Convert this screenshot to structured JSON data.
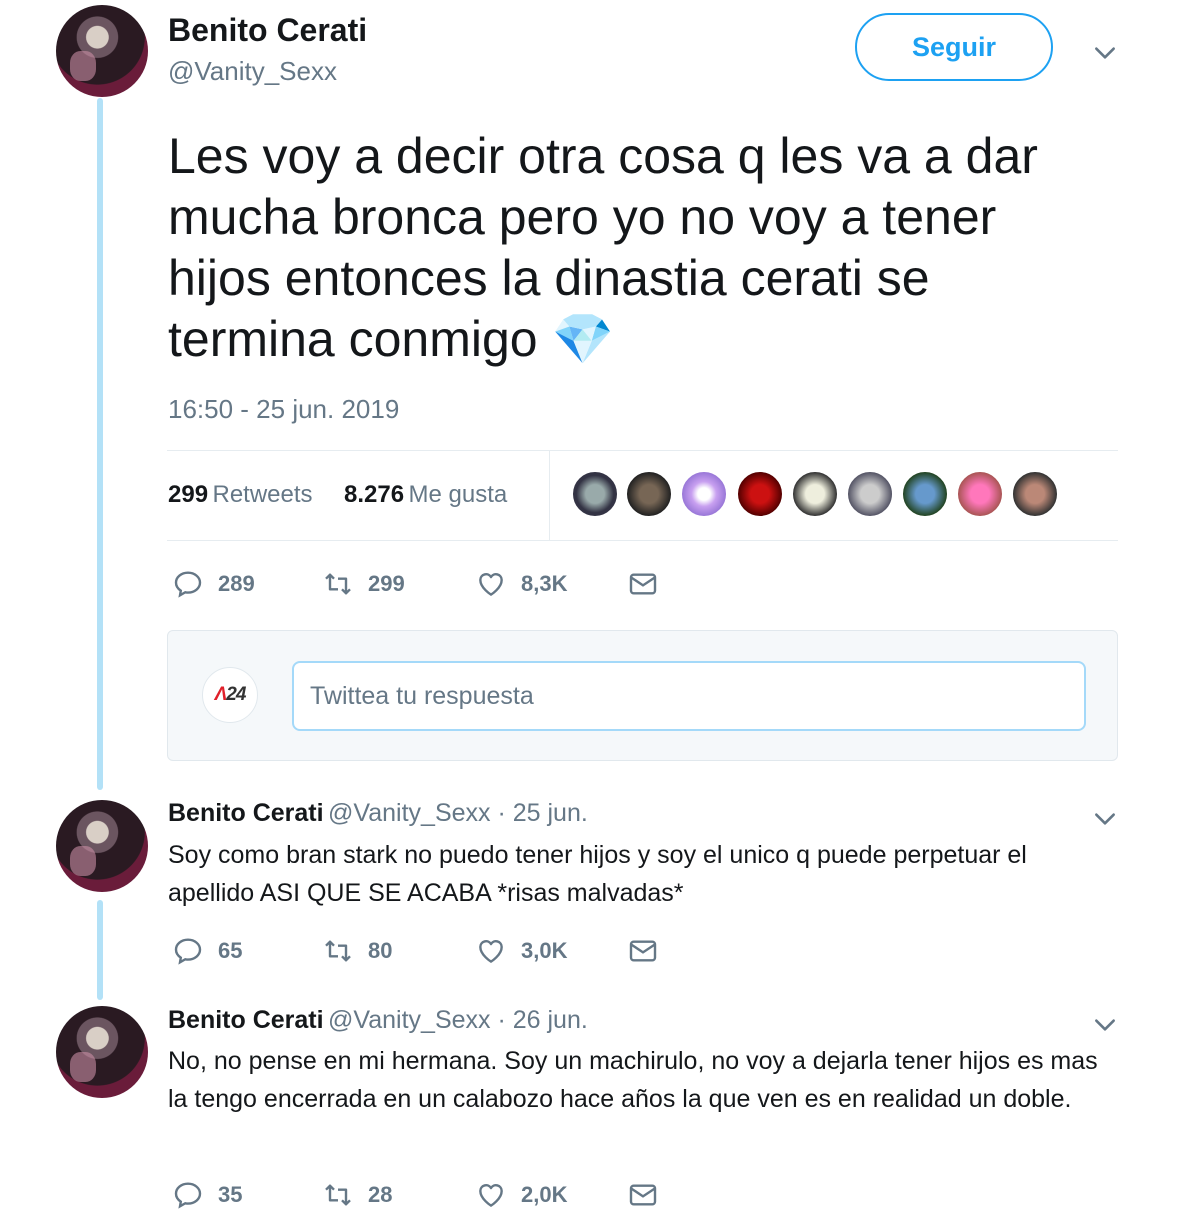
{
  "main_tweet": {
    "author_name": "Benito Cerati",
    "author_handle": "@Vanity_Sexx",
    "follow_label": "Seguir",
    "text": "Les voy a decir otra cosa q les va a dar mucha bronca pero yo no voy a tener hijos entonces la dinastia cerati se termina conmigo",
    "emoji": "💎",
    "timestamp": "16:50 - 25 jun. 2019",
    "stats": {
      "retweets_count": "299",
      "retweets_label": "Retweets",
      "likes_count": "8.276",
      "likes_label": "Me gusta"
    },
    "actions": {
      "replies": "289",
      "retweets": "299",
      "likes": "8,3K"
    }
  },
  "reply_composer": {
    "placeholder": "Twittea tu respuesta",
    "logo_prefix": "Λ",
    "logo_text": "24"
  },
  "replies": [
    {
      "author_name": "Benito Cerati",
      "meta": "@Vanity_Sexx · 25 jun.",
      "text": "Soy como bran stark no puedo tener hijos y soy el unico q puede perpetuar el apellido ASI QUE SE ACABA *risas malvadas*",
      "replies": "65",
      "retweets": "80",
      "likes": "3,0K"
    },
    {
      "author_name": "Benito Cerati",
      "meta": "@Vanity_Sexx · 26 jun.",
      "text": "No, no pense en mi hermana. Soy un machirulo, no voy a dejarla tener hijos es mas la tengo encerrada en un calabozo hace años la que ven es en realidad un doble.",
      "replies": "35",
      "retweets": "28",
      "likes": "2,0K"
    }
  ],
  "colors": {
    "accent": "#1da1f2",
    "muted": "#657786",
    "thread": "#b3e1f7"
  }
}
